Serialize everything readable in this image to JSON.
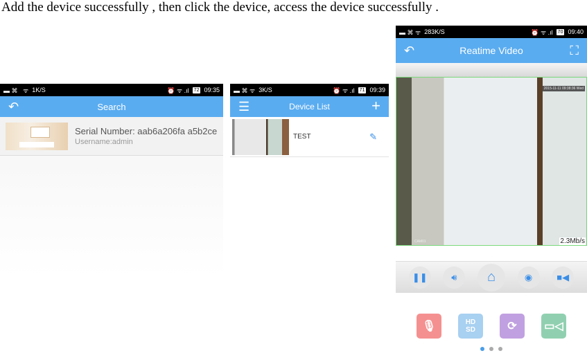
{
  "caption": "Add the device successfully , then click the device, access the device successfully .",
  "phones": [
    {
      "status": {
        "speed": "1K/S",
        "battery": "72",
        "time": "09:35"
      },
      "header": {
        "title": "Search",
        "back_icon": "back-arrow-icon"
      },
      "result": {
        "serial": "Serial Number: aab6a206fa a5b2ce",
        "username": "Username:admin"
      }
    },
    {
      "status": {
        "speed": "3K/S",
        "battery": "71",
        "time": "09:39"
      },
      "header": {
        "title": "Device List",
        "menu_icon": "list-menu-icon",
        "add_icon": "plus-icon"
      },
      "device": {
        "name": "TEST",
        "edit_icon": "edit-icon"
      }
    },
    {
      "status": {
        "speed": "283K/S",
        "battery": "70",
        "time": "09:40"
      },
      "header": {
        "title": "Reatime Video",
        "back_icon": "back-arrow-icon",
        "fullscreen_icon": "fullscreen-icon"
      },
      "video": {
        "timestamp": "2015-11-11 09:38:36 Wed",
        "camera": "CAM01",
        "bitrate": "2.3Mb/s"
      },
      "controls": [
        "pause",
        "volume",
        "home",
        "snapshot",
        "record"
      ],
      "tools": [
        {
          "name": "microphone",
          "color": "#f59090"
        },
        {
          "name": "HD/SD",
          "color": "#a8d0f0"
        },
        {
          "name": "refresh",
          "color": "#c0a0e0"
        },
        {
          "name": "video",
          "color": "#90d0b0"
        }
      ],
      "page_indicator": {
        "total": 3,
        "active": 1
      }
    }
  ]
}
